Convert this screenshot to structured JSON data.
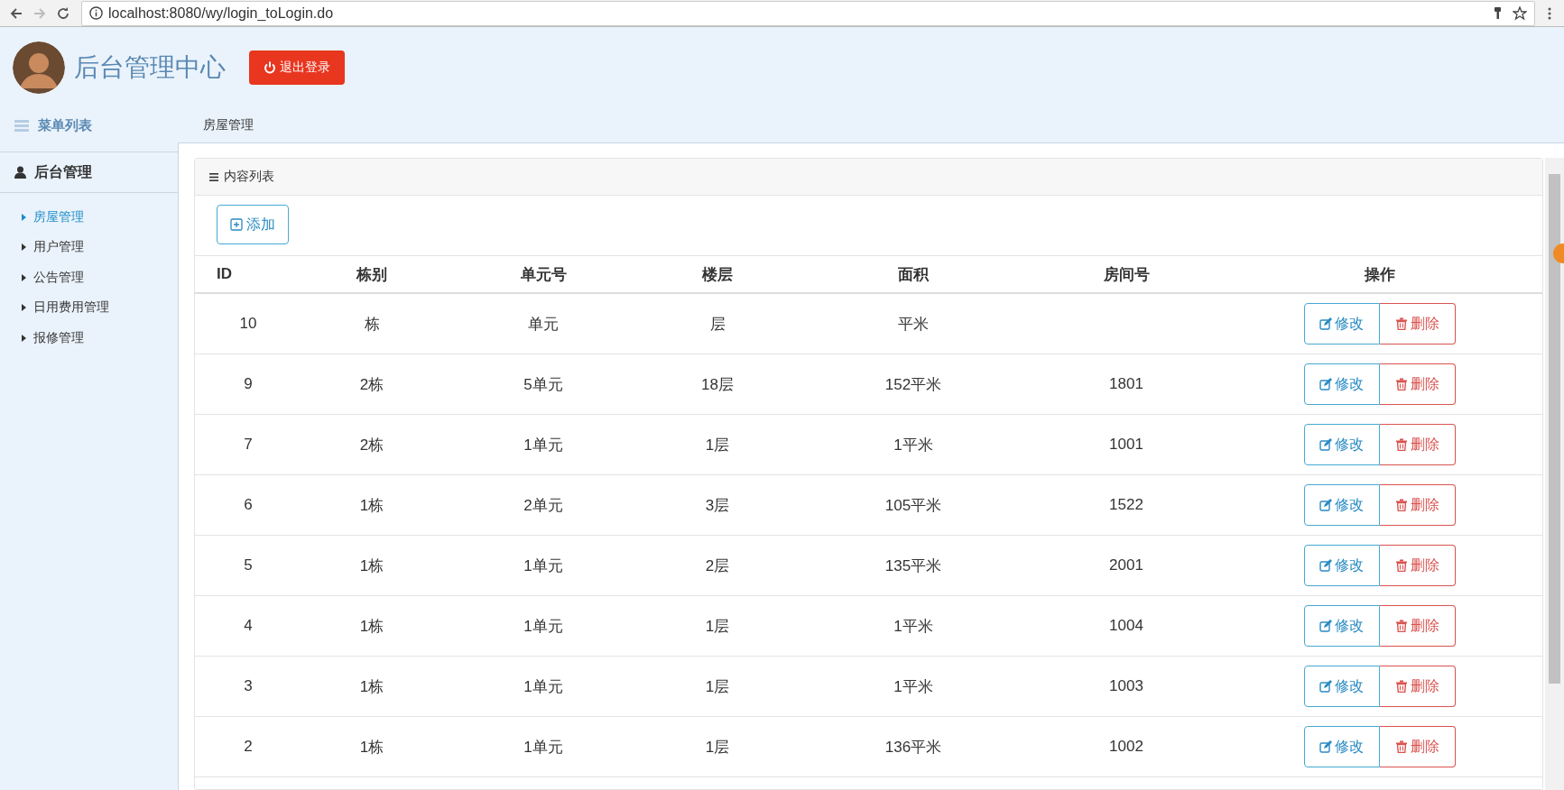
{
  "browser": {
    "nav": [
      {
        "kind": "back",
        "disabled": false
      },
      {
        "kind": "forward",
        "disabled": true
      },
      {
        "kind": "reload",
        "disabled": false
      }
    ],
    "url": "localhost:8080/wy/login_toLogin.do"
  },
  "header": {
    "title": "后台管理中心",
    "logout": "退出登录"
  },
  "sidebar": {
    "title": "菜单列表",
    "section": {
      "label": "后台管理",
      "items": [
        {
          "label": "房屋管理",
          "selected": true
        },
        {
          "label": "用户管理",
          "selected": false
        },
        {
          "label": "公告管理",
          "selected": false
        },
        {
          "label": "日用费用管理",
          "selected": false
        },
        {
          "label": "报修管理",
          "selected": false
        }
      ]
    }
  },
  "breadcrumb": "房屋管理",
  "panel": {
    "title": "内容列表",
    "add_button": "添加"
  },
  "table": {
    "columns": [
      "ID",
      "栋别",
      "单元号",
      "楼层",
      "面积",
      "房间号",
      "操作"
    ],
    "rows": [
      {
        "cells": [
          "10",
          "栋",
          "单元",
          "层",
          "平米"
        ],
        "actions": [
          "修改",
          "删除"
        ]
      },
      {
        "cells": [
          "9",
          "2栋",
          "5单元",
          "18层",
          "152平米",
          "1801"
        ],
        "actions": [
          "修改",
          "删除"
        ]
      },
      {
        "cells": [
          "7",
          "2栋",
          "1单元",
          "1层",
          "1平米",
          "1001"
        ],
        "actions": [
          "修改",
          "删除"
        ]
      },
      {
        "cells": [
          "6",
          "1栋",
          "2单元",
          "3层",
          "105平米",
          "1522"
        ],
        "actions": [
          "修改",
          "删除"
        ]
      },
      {
        "cells": [
          "5",
          "1栋",
          "1单元",
          "2层",
          "135平米",
          "2001"
        ],
        "actions": [
          "修改",
          "删除"
        ]
      },
      {
        "cells": [
          "4",
          "1栋",
          "1单元",
          "1层",
          "1平米",
          "1004"
        ],
        "actions": [
          "修改",
          "删除"
        ]
      },
      {
        "cells": [
          "3",
          "1栋",
          "1单元",
          "1层",
          "1平米",
          "1003"
        ],
        "actions": [
          "修改",
          "删除"
        ]
      },
      {
        "cells": [
          "2",
          "1栋",
          "1单元",
          "1层",
          "136平米",
          "1002"
        ],
        "actions": [
          "修改",
          "删除"
        ]
      }
    ]
  }
}
